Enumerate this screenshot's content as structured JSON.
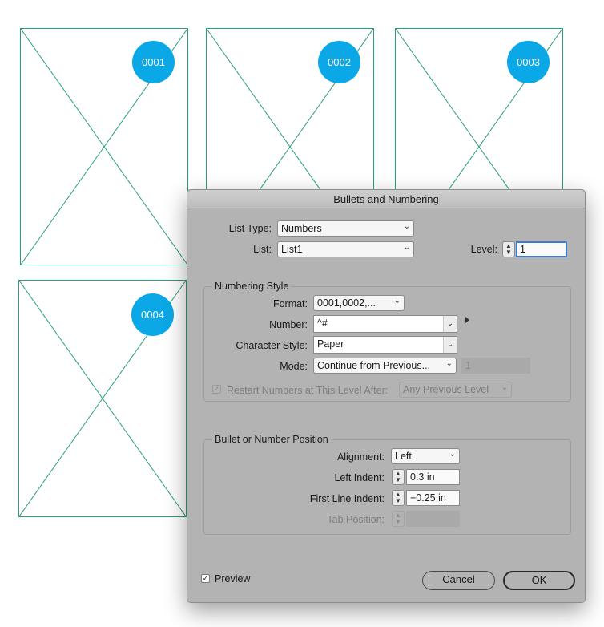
{
  "frames": [
    {
      "badge": "0001"
    },
    {
      "badge": "0002"
    },
    {
      "badge": "0003"
    },
    {
      "badge": "0004"
    }
  ],
  "dialog": {
    "title": "Bullets and Numbering",
    "list_type_label": "List Type:",
    "list_type_value": "Numbers",
    "list_label": "List:",
    "list_value": "List1",
    "level_label": "Level:",
    "level_value": "1",
    "numbering_style": {
      "title": "Numbering Style",
      "format_label": "Format:",
      "format_value": "0001,0002,...",
      "number_label": "Number:",
      "number_value": "^#",
      "char_style_label": "Character Style:",
      "char_style_value": "Paper",
      "mode_label": "Mode:",
      "mode_value": "Continue from Previous...",
      "mode_start_value": "1",
      "restart_label": "Restart Numbers at This Level After:",
      "restart_checked": true,
      "restart_value": "Any Previous Level"
    },
    "position": {
      "title": "Bullet or Number Position",
      "alignment_label": "Alignment:",
      "alignment_value": "Left",
      "left_indent_label": "Left Indent:",
      "left_indent_value": "0.3 in",
      "first_line_label": "First Line Indent:",
      "first_line_value": "−0.25 in",
      "tab_position_label": "Tab Position:",
      "tab_position_value": ""
    },
    "preview_label": "Preview",
    "preview_checked": true,
    "cancel_label": "Cancel",
    "ok_label": "OK"
  },
  "colors": {
    "frame_stroke": "#2a9e7c",
    "badge_fill": "#0aa8e6",
    "dialog_bg": "#b3b3b3",
    "focus_ring": "#3a7bd5"
  },
  "icons": [
    "chevron-down-icon",
    "stepper-icon",
    "checkmark-icon",
    "disclosure-arrow-icon",
    "placeholder-x-icon"
  ]
}
